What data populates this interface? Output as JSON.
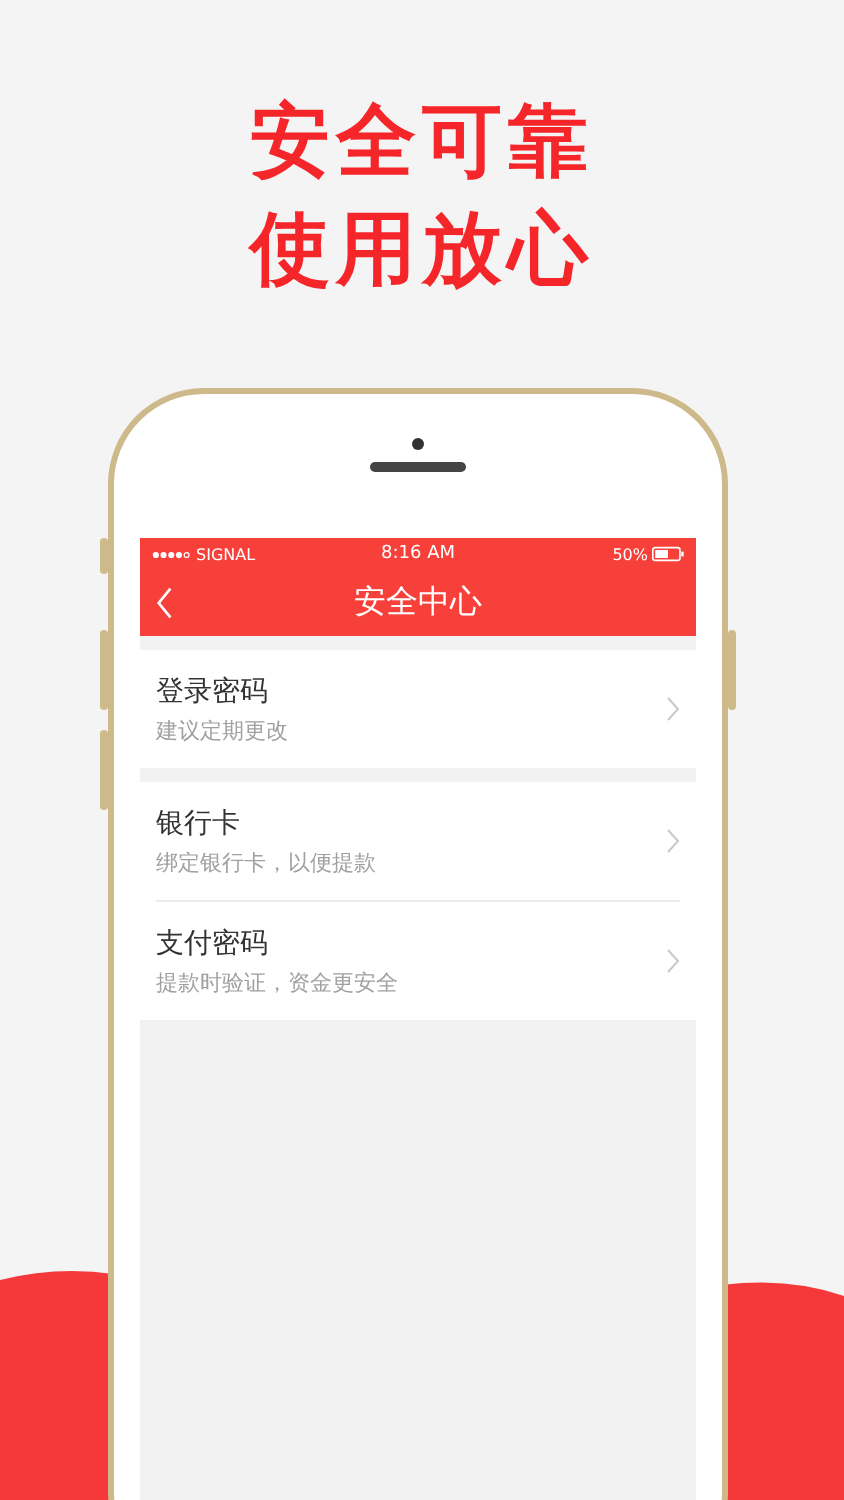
{
  "headline": [
    "安全可靠",
    "使用放心"
  ],
  "status_bar": {
    "carrier": "SIGNAL",
    "time": "8:16 AM",
    "battery": "50%"
  },
  "nav": {
    "title": "安全中心"
  },
  "groups": [
    {
      "items": [
        {
          "title": "登录密码",
          "subtitle": "建议定期更改"
        }
      ]
    },
    {
      "items": [
        {
          "title": "银行卡",
          "subtitle": "绑定银行卡，以便提款"
        },
        {
          "title": "支付密码",
          "subtitle": "提款时验证，资金更安全"
        }
      ]
    }
  ]
}
